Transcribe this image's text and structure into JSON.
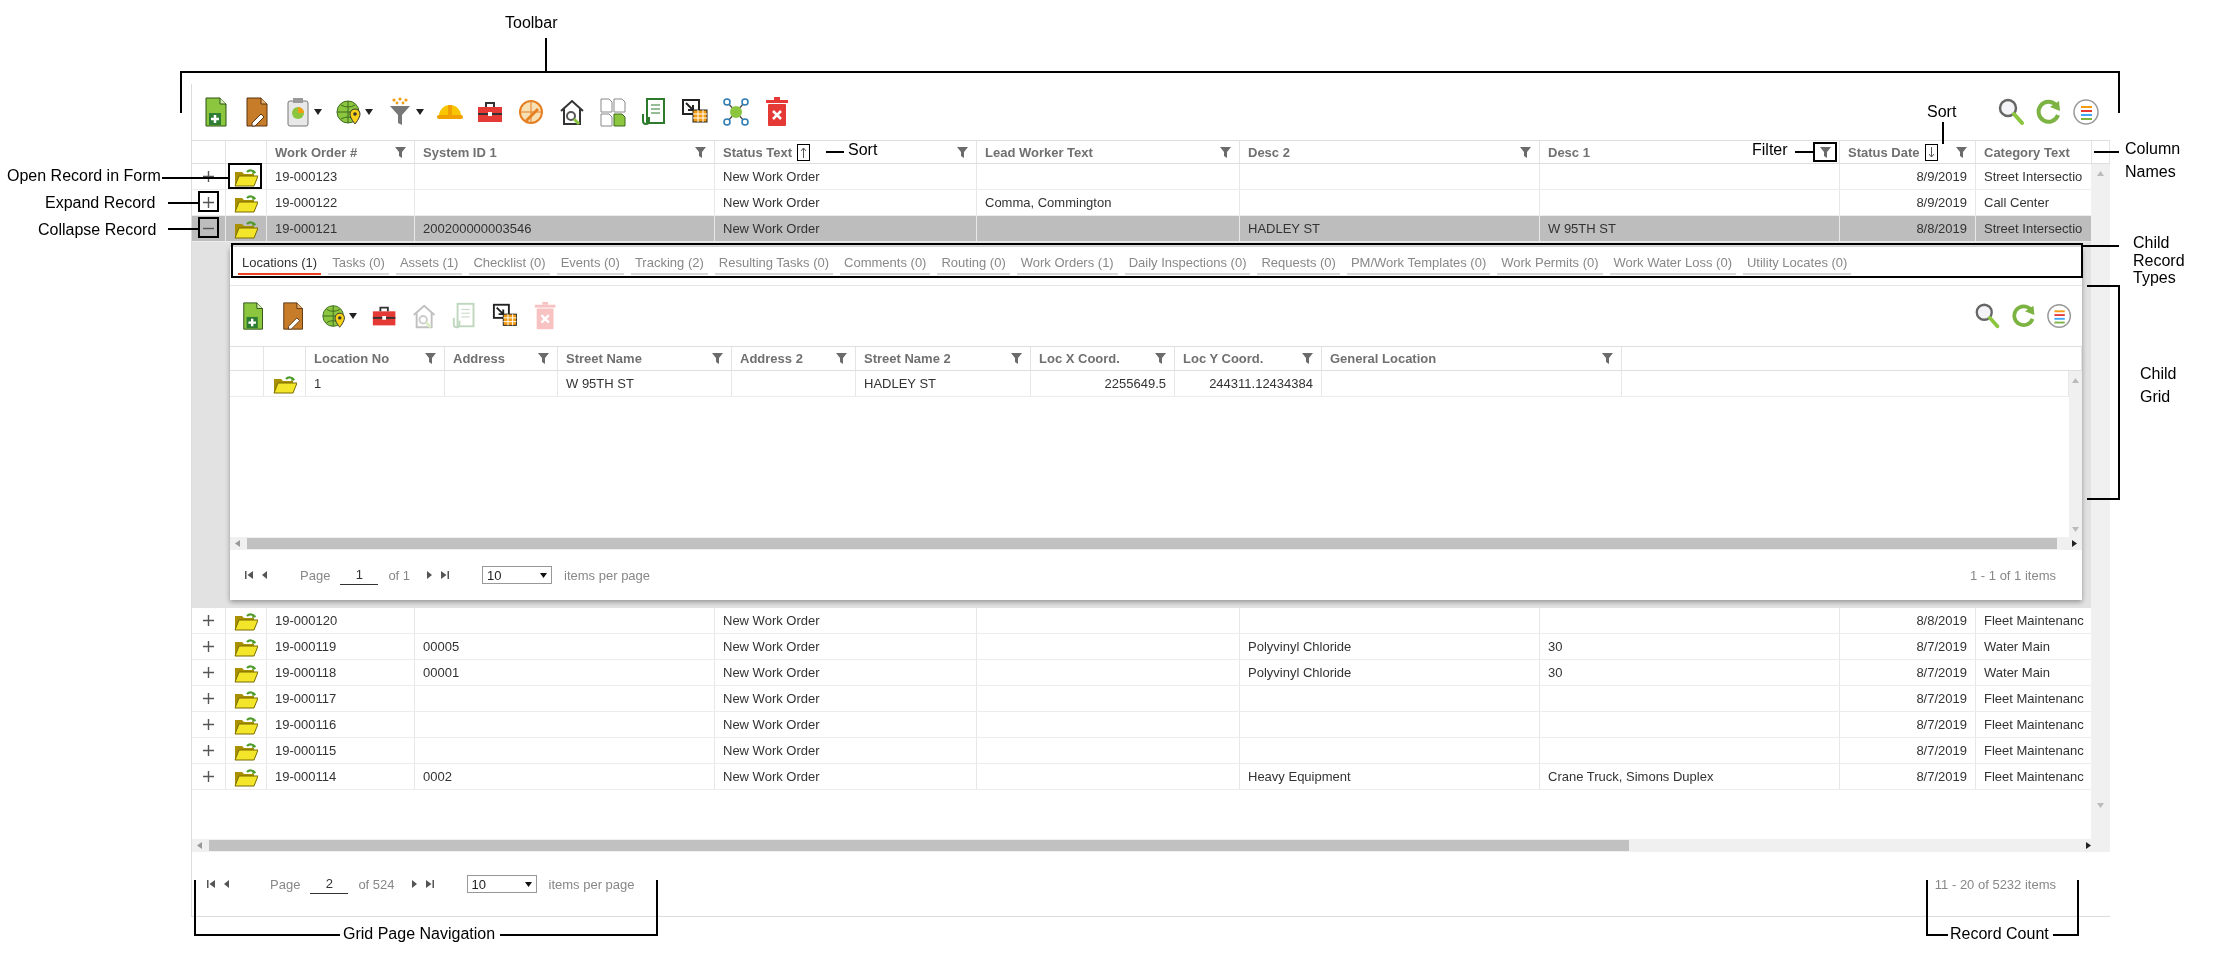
{
  "grid": {
    "toolbar": {
      "items": [
        {
          "kind": "new",
          "disabled": false,
          "dropdown": false
        },
        {
          "kind": "edit",
          "disabled": false,
          "dropdown": false
        },
        {
          "kind": "report",
          "disabled": false,
          "dropdown": true
        },
        {
          "kind": "map",
          "disabled": false,
          "dropdown": true
        },
        {
          "kind": "funnel",
          "disabled": false,
          "dropdown": true
        },
        {
          "kind": "hardhat",
          "disabled": false,
          "dropdown": false
        },
        {
          "kind": "toolbox",
          "disabled": false,
          "dropdown": false
        },
        {
          "kind": "globe-pencil",
          "disabled": false,
          "dropdown": false
        },
        {
          "kind": "house-search",
          "disabled": false,
          "dropdown": false
        },
        {
          "kind": "copy",
          "disabled": false,
          "dropdown": false
        },
        {
          "kind": "doc-clip",
          "disabled": false,
          "dropdown": false
        },
        {
          "kind": "export",
          "disabled": false,
          "dropdown": false
        },
        {
          "kind": "network",
          "disabled": false,
          "dropdown": false
        },
        {
          "kind": "trash",
          "disabled": false,
          "dropdown": false
        }
      ],
      "right_tools": [
        {
          "kind": "search"
        },
        {
          "kind": "refresh"
        },
        {
          "kind": "list"
        }
      ]
    },
    "columns": [
      {
        "label": "Work Order #",
        "kind": "text",
        "sort_ascending": false,
        "sort_descending": false,
        "filterable": true
      },
      {
        "label": "System ID 1",
        "kind": "text",
        "sort_ascending": false,
        "sort_descending": false,
        "filterable": true
      },
      {
        "label": "Status Text",
        "kind": "text",
        "sort_ascending": true,
        "sort_descending": false,
        "filterable": true
      },
      {
        "label": "Lead Worker Text",
        "kind": "text",
        "sort_ascending": false,
        "sort_descending": false,
        "filterable": true
      },
      {
        "label": "Desc 2",
        "kind": "text",
        "sort_ascending": false,
        "sort_descending": false,
        "filterable": true
      },
      {
        "label": "Desc 1",
        "kind": "text",
        "sort_ascending": false,
        "sort_descending": false,
        "filterable": true
      },
      {
        "label": "Status Date",
        "kind": "date",
        "sort_ascending": false,
        "sort_descending": true,
        "filterable": true
      },
      {
        "label": "Category Text",
        "kind": "text",
        "sort_ascending": false,
        "sort_descending": false,
        "filterable": false
      }
    ],
    "rows": [
      {
        "expanded": false,
        "selected": false,
        "cells": [
          "19-000123",
          null,
          "New Work Order",
          null,
          null,
          null,
          "8/9/2019",
          "Street Intersectio"
        ]
      },
      {
        "expanded": false,
        "selected": false,
        "cells": [
          "19-000122",
          null,
          "New Work Order",
          "Comma, Commington",
          null,
          null,
          "8/9/2019",
          "Call Center"
        ]
      },
      {
        "expanded": true,
        "selected": true,
        "cells": [
          "19-000121",
          "200200000003546",
          "New Work Order",
          null,
          "HADLEY ST",
          "W 95TH ST",
          "8/8/2019",
          "Street Intersectio"
        ],
        "detail": {
          "tabs": [
            {
              "label": "Locations (1)",
              "selected": true
            },
            {
              "label": "Tasks (0)",
              "selected": false
            },
            {
              "label": "Assets (1)",
              "selected": false
            },
            {
              "label": "Checklist (0)",
              "selected": false
            },
            {
              "label": "Events (0)",
              "selected": false
            },
            {
              "label": "Tracking (2)",
              "selected": false
            },
            {
              "label": "Resulting Tasks (0)",
              "selected": false
            },
            {
              "label": "Comments (0)",
              "selected": false
            },
            {
              "label": "Routing (0)",
              "selected": false
            },
            {
              "label": "Work Orders (1)",
              "selected": false
            },
            {
              "label": "Daily Inspections (0)",
              "selected": false
            },
            {
              "label": "Requests (0)",
              "selected": false
            },
            {
              "label": "PM/Work Templates (0)",
              "selected": false
            },
            {
              "label": "Work Permits (0)",
              "selected": false
            },
            {
              "label": "Work Water Loss (0)",
              "selected": false
            },
            {
              "label": "Utility Locates (0)",
              "selected": false
            }
          ],
          "toolbar": {
            "items": [
              {
                "kind": "new",
                "disabled": false,
                "dropdown": false
              },
              {
                "kind": "edit",
                "disabled": false,
                "dropdown": false
              },
              {
                "kind": "map",
                "disabled": false,
                "dropdown": true
              },
              {
                "kind": "toolbox",
                "disabled": false,
                "dropdown": false
              },
              {
                "kind": "house-search",
                "disabled": true,
                "dropdown": false
              },
              {
                "kind": "doc-clip",
                "disabled": true,
                "dropdown": false
              },
              {
                "kind": "export",
                "disabled": false,
                "dropdown": false
              },
              {
                "kind": "trash",
                "disabled": true,
                "dropdown": false
              }
            ],
            "right_tools": [
              {
                "kind": "search"
              },
              {
                "kind": "refresh"
              },
              {
                "kind": "list"
              }
            ]
          },
          "columns": [
            {
              "label": "Location No",
              "kind": "text",
              "filterable": true
            },
            {
              "label": "Address",
              "kind": "text",
              "filterable": true
            },
            {
              "label": "Street Name",
              "kind": "text",
              "filterable": true
            },
            {
              "label": "Address 2",
              "kind": "text",
              "filterable": true
            },
            {
              "label": "Street Name 2",
              "kind": "text",
              "filterable": true
            },
            {
              "label": "Loc X Coord.",
              "kind": "number",
              "filterable": true
            },
            {
              "label": "Loc Y Coord.",
              "kind": "number",
              "filterable": true
            },
            {
              "label": "General Location",
              "kind": "text",
              "filterable": true
            }
          ],
          "rows": [
            {
              "cells": [
                "1",
                null,
                "W 95TH ST",
                null,
                "HADLEY ST",
                "2255649.5",
                "244311.12434384",
                null
              ]
            }
          ],
          "pager": {
            "page_label": "Page",
            "page": "1",
            "of": "of 1",
            "page_size": "10",
            "page_size_label": "items per page",
            "count": "1 - 1 of 1 items"
          }
        }
      },
      {
        "expanded": false,
        "selected": false,
        "cells": [
          "19-000120",
          null,
          "New Work Order",
          null,
          null,
          null,
          "8/8/2019",
          "Fleet Maintenanc"
        ]
      },
      {
        "expanded": false,
        "selected": false,
        "cells": [
          "19-000119",
          "00005",
          "New Work Order",
          null,
          "Polyvinyl Chloride",
          "30",
          "8/7/2019",
          "Water Main"
        ]
      },
      {
        "expanded": false,
        "selected": false,
        "cells": [
          "19-000118",
          "00001",
          "New Work Order",
          null,
          "Polyvinyl Chloride",
          "30",
          "8/7/2019",
          "Water Main"
        ]
      },
      {
        "expanded": false,
        "selected": false,
        "cells": [
          "19-000117",
          null,
          "New Work Order",
          null,
          null,
          null,
          "8/7/2019",
          "Fleet Maintenanc"
        ]
      },
      {
        "expanded": false,
        "selected": false,
        "cells": [
          "19-000116",
          null,
          "New Work Order",
          null,
          null,
          null,
          "8/7/2019",
          "Fleet Maintenanc"
        ]
      },
      {
        "expanded": false,
        "selected": false,
        "cells": [
          "19-000115",
          null,
          "New Work Order",
          null,
          null,
          null,
          "8/7/2019",
          "Fleet Maintenanc"
        ]
      },
      {
        "expanded": false,
        "selected": false,
        "cells": [
          "19-000114",
          "0002",
          "New Work Order",
          null,
          "Heavy Equipment",
          "Crane Truck, Simons Duplex",
          "8/7/2019",
          "Fleet Maintenanc"
        ]
      }
    ],
    "pager": {
      "page_label": "Page",
      "page": "2",
      "of": "of 524",
      "page_size": "10",
      "page_size_label": "items per page",
      "count": "11 - 20 of 5232 items"
    }
  },
  "annotations": [
    {
      "text": "Toolbar"
    },
    {
      "text": "Sort"
    },
    {
      "text": "Sort"
    },
    {
      "text": "Filter"
    },
    {
      "text": "Column Names"
    },
    {
      "text": "Open Record in Form"
    },
    {
      "text": "Expand Record"
    },
    {
      "text": "Collapse Record"
    },
    {
      "text": "Child Record Types"
    },
    {
      "text": "Child Grid"
    },
    {
      "text": "Grid Page Navigation"
    },
    {
      "text": "Record Count"
    }
  ]
}
